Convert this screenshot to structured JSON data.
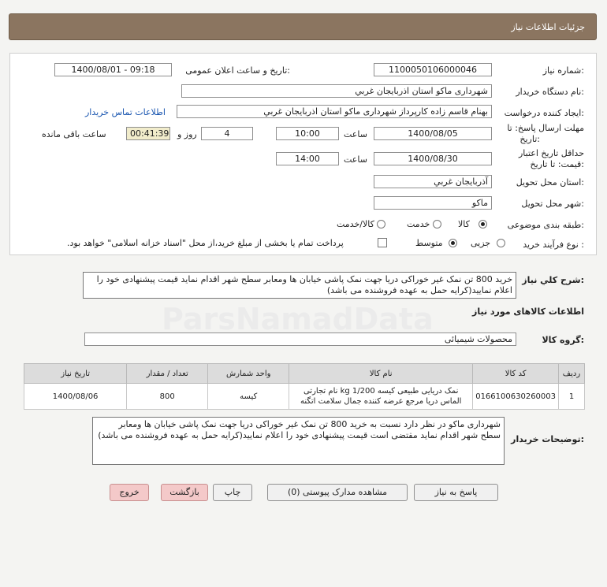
{
  "header": {
    "title": "جزئیات اطلاعات نیاز"
  },
  "watermark": {
    "text": "ParsNamadData"
  },
  "form": {
    "need_number": {
      "label": "شماره نیاز:",
      "value": "1100050106000046"
    },
    "announce": {
      "label": "تاریخ و ساعت اعلان عمومی:",
      "value": "1400/08/01 - 09:18"
    },
    "buyer_org": {
      "label": "نام دستگاه خریدار:",
      "value": "شهرداری ماکو استان اذربایجان غربي"
    },
    "creator": {
      "label": "ایجاد کننده درخواست:",
      "value": "بهنام قاسم زاده کارپرداز شهرداری ماکو استان اذربایجان غربي",
      "contact_link": "اطلاعات تماس خریدار"
    },
    "deadline": {
      "label_line1": "مهلت ارسال پاسخ: تا",
      "label_line2": "تاریخ:",
      "date": "1400/08/05",
      "time_label": "ساعت",
      "time": "10:00",
      "days": "4",
      "days_label": "روز و",
      "remaining": "00:41:39",
      "remaining_label": "ساعت باقی مانده"
    },
    "validity": {
      "label_line1": "حداقل تاریخ اعتبار",
      "label_line2": "قیمت: تا تاریخ:",
      "date": "1400/08/30",
      "time_label": "ساعت",
      "time": "14:00"
    },
    "province": {
      "label": "استان محل تحویل:",
      "value": "آذربایجان غربي"
    },
    "city": {
      "label": "شهر محل تحویل:",
      "value": "ماکو"
    },
    "category": {
      "label": "طبقه بندی موضوعی:",
      "options": [
        "کالا",
        "خدمت",
        "کالا/خدمت"
      ],
      "selected": "کالا"
    },
    "process": {
      "label": "نوع فرآیند خرید :",
      "options": [
        "جزیی",
        "متوسط"
      ],
      "selected": "متوسط",
      "payment_note": "پرداخت تمام یا بخشی از مبلغ خرید،از محل \"اسناد خزانه اسلامی\" خواهد بود."
    }
  },
  "description": {
    "label": "شرح کلي نياز:",
    "text": "خرید 800 تن نمک غیر خوراکی دریا جهت نمک پاشی خیابان ها ومعابر سطح شهر اقدام نماید قیمت پیشنهادی خود را اعلام نمایید(کرایه حمل به عهده فروشنده می باشد)"
  },
  "goods_info": {
    "title": "اطلاعات کالاهای مورد نیاز",
    "group_label": "گروه کالا:",
    "group_value": "محصولات شیمیائی"
  },
  "table": {
    "headers": [
      "ردیف",
      "کد کالا",
      "نام کالا",
      "واحد شمارش",
      "تعداد / مقدار",
      "تاریخ نیاز"
    ],
    "rows": [
      {
        "row": "1",
        "code": "0166100630260003",
        "name": "نمک دریایی طبیعی کیسه 1/200 kg نام تجارتی الماس دریا مرجع عرضه کننده جمال سلامت اتگنه",
        "unit": "کیسه",
        "qty": "800",
        "date": "1400/08/06"
      }
    ]
  },
  "buyer_notes": {
    "label": "توضیحات خریدار:",
    "text": "شهرداری ماکو در نظر دارد نسبت به خرید 800 تن نمک غیر خوراکی دریا جهت نمک پاشی خیابان ها ومعابر سطح شهر اقدام نماید مقتضی است قیمت پیشنهادی خود را اعلام نمایید(کرایه حمل به عهده فروشنده می باشد)"
  },
  "buttons": {
    "reply": "پاسخ به نیاز",
    "docs": "مشاهده مدارک پیوستی (0)",
    "print": "چاپ",
    "back": "بازگشت",
    "exit": "خروج"
  }
}
